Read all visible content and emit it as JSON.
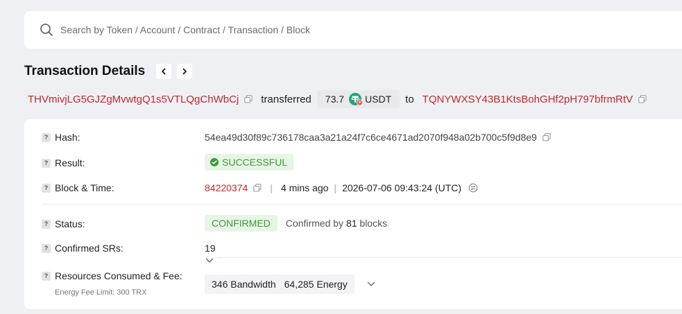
{
  "search": {
    "placeholder": "Search by Token / Account / Contract / Transaction / Block"
  },
  "header": {
    "title": "Transaction Details"
  },
  "transfer": {
    "from_address": "THVmivjLG5GJZgMvwtgQ1s5VTLQgChWbCj",
    "verb": "transferred",
    "amount": "73.7",
    "token": "USDT",
    "to_word": "to",
    "to_address": "TQNYWXSY43B1KtsBohGHf2pH797bfrmRtV"
  },
  "details": {
    "hash_label": "Hash:",
    "hash_value": "54ea49d30f89c736178caa3a21a24f7c6ce4671ad2070f948a02b700c5f9d8e9",
    "result_label": "Result:",
    "result_value": "SUCCESSFUL",
    "block_time_label": "Block & Time:",
    "block_number": "84220374",
    "separator": "|",
    "time_ago": "4 mins ago",
    "timestamp": "2026-07-06 09:43:24 (UTC)",
    "status_label": "Status:",
    "status_value": "CONFIRMED",
    "confirmed_by_prefix": "Confirmed by",
    "confirmed_blocks": "81",
    "confirmed_by_suffix": "blocks",
    "confirmed_srs_label": "Confirmed SRs:",
    "confirmed_srs_value": "19",
    "resources_label": "Resources Consumed & Fee:",
    "energy_fee_limit": "Energy Fee Limit: 300 TRX",
    "bandwidth": "346 Bandwidth",
    "energy": "64,285 Energy",
    "help_glyph": "?"
  },
  "colors": {
    "link_red": "#c0282b",
    "success_green": "#3b9a38",
    "success_bg": "#e8f5e6",
    "tether_green": "#26a17b"
  }
}
